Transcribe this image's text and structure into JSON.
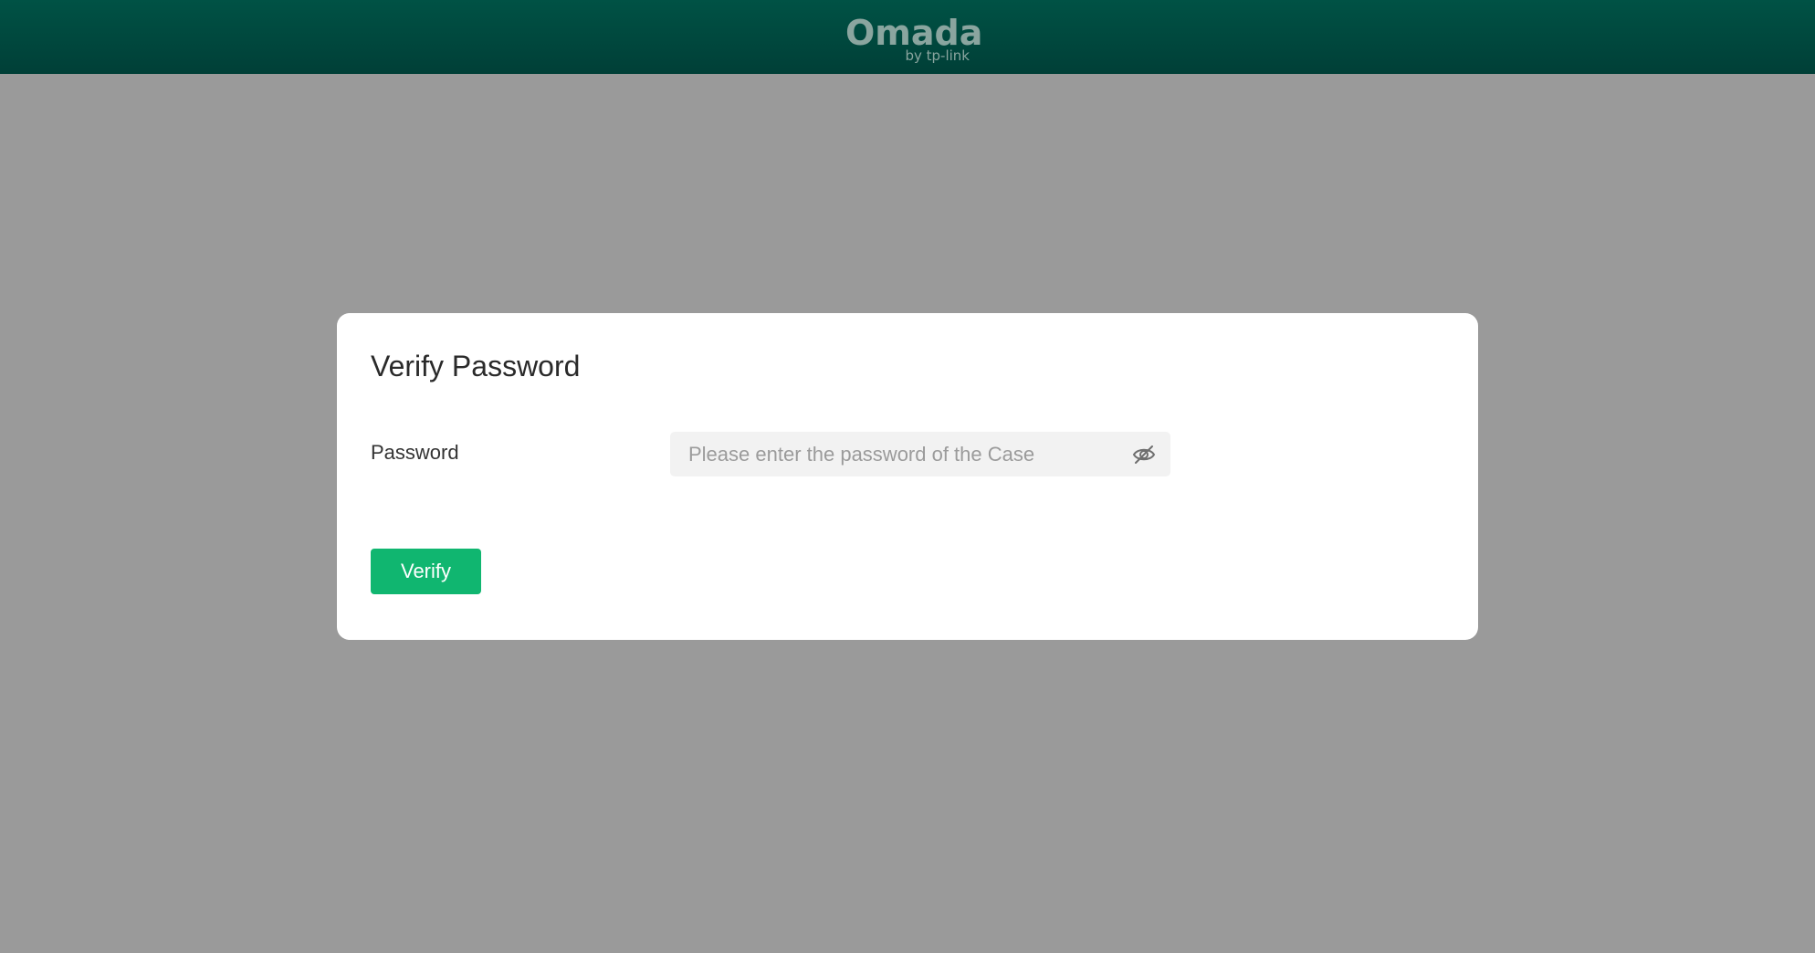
{
  "header": {
    "logo_text": "Omada",
    "logo_subtext": "by tp-link"
  },
  "dialog": {
    "title": "Verify Password",
    "password_label": "Password",
    "password_placeholder": "Please enter the password of the Case",
    "password_value": "",
    "verify_label": "Verify"
  },
  "icons": {
    "visibility_toggle": "eye-off-icon"
  },
  "colors": {
    "header_bg": "#004a40",
    "overlay_bg": "#9a9a9a",
    "primary_button": "#10b670",
    "logo": "#8aa59f"
  }
}
